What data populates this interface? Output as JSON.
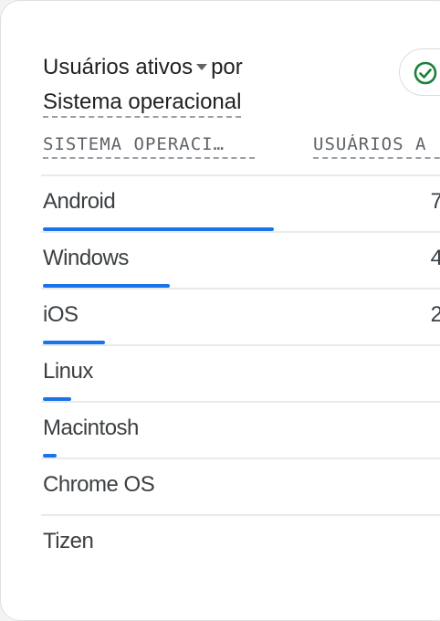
{
  "card": {
    "title_metric": "Usuários ativos",
    "title_connector": "por",
    "title_dimension": "Sistema operacional",
    "status_icon": "check-circle-icon",
    "accent_color": "#1a73e8",
    "check_color": "#188038"
  },
  "table": {
    "columns": [
      "SISTEMA OPERACI…",
      "USUÁRIOS A"
    ],
    "rows": [
      {
        "label": "Android",
        "value": "7",
        "share": 0.575
      },
      {
        "label": "Windows",
        "value": "4",
        "share": 0.315
      },
      {
        "label": "iOS",
        "value": "2",
        "share": 0.155
      },
      {
        "label": "Linux",
        "value": "",
        "share": 0.07
      },
      {
        "label": "Macintosh",
        "value": "",
        "share": 0.035
      },
      {
        "label": "Chrome OS",
        "value": "",
        "share": 0
      },
      {
        "label": "Tizen",
        "value": "",
        "share": 0
      }
    ]
  }
}
